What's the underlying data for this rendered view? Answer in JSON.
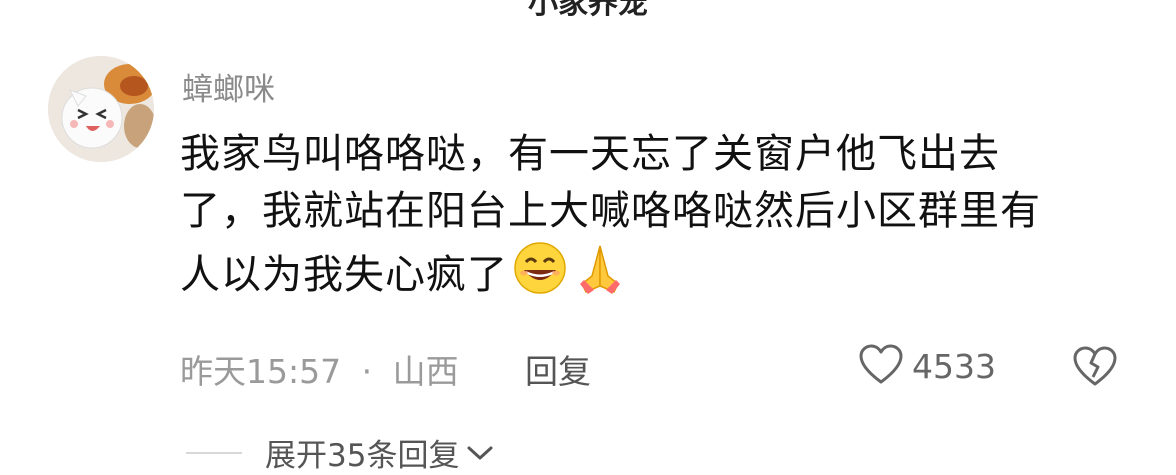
{
  "top_text": "小家养宠",
  "comment": {
    "username": "蟑螂咪",
    "line1": "我家鸟叫咯咯哒，有一天忘了关窗户他飞出去",
    "line2": "了，我就站在阳台上大喊咯咯哒然后小区群里有",
    "line3": "人以为我失心疯了",
    "time": "昨天15:57",
    "separator": "·",
    "location": "山西",
    "reply_label": "回复",
    "like_count": "4533",
    "expand_label": "展开35条回复"
  },
  "icons": {
    "like": "heart-outline-icon",
    "dislike": "broken-heart-icon",
    "expand": "chevron-down-icon",
    "emoji1": "grinning-face-emoji",
    "emoji2": "folded-hands-emoji"
  },
  "colors": {
    "text": "#111111",
    "secondary": "#9a9a9a",
    "username": "#8a8a8a"
  }
}
